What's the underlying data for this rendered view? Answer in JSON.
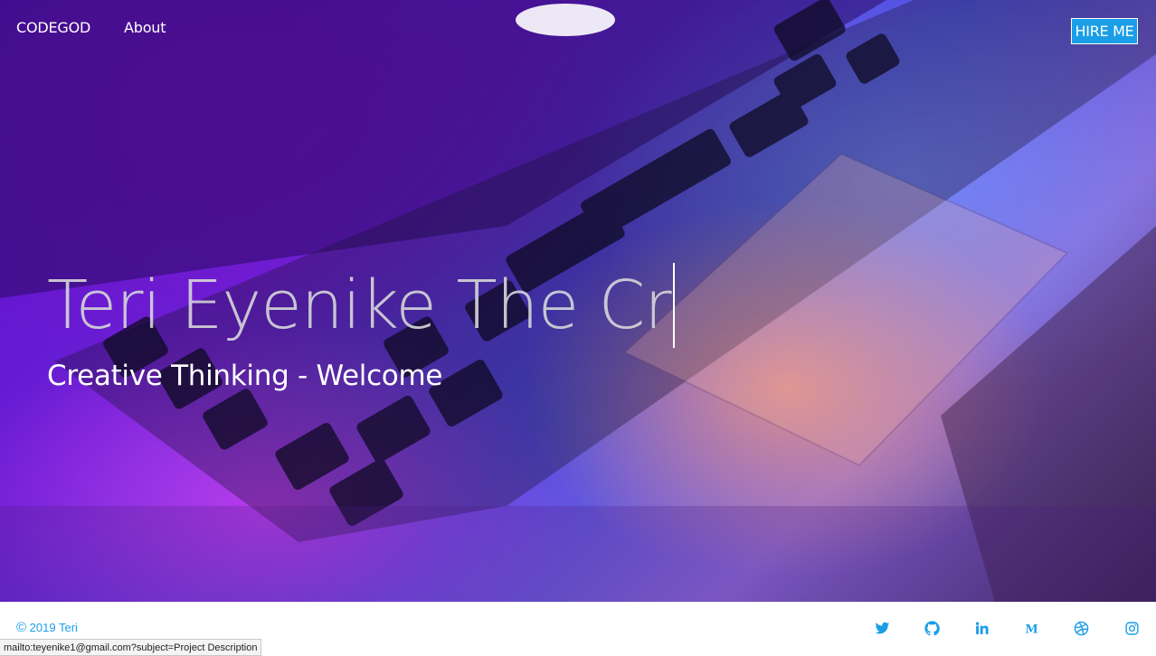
{
  "nav": {
    "brand": "CODEGOD",
    "about": "About",
    "hire": "HIRE ME"
  },
  "hero": {
    "headline": "Teri Eyenike The Cr",
    "tagline": "Creative Thinking - Welcome"
  },
  "footer": {
    "copyright_symbol": "©",
    "copyright_text": " 2019 Teri",
    "social": [
      "twitter-icon",
      "github-icon",
      "linkedin-icon",
      "medium-icon",
      "dribbble-icon",
      "instagram-icon"
    ],
    "medium_letter": "M"
  },
  "status_bar": "mailto:teyenike1@gmail.com?subject=Project Description",
  "colors": {
    "accent": "#1a9ee8",
    "hero_purple": "#6a1fd6",
    "hero_blue": "#4a4de0"
  }
}
